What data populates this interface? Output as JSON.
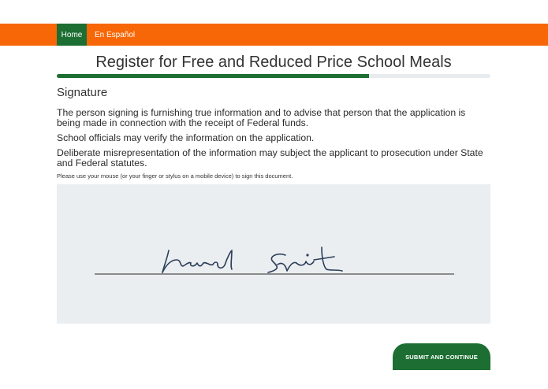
{
  "nav": {
    "home_label": "Home",
    "spanish_label": "En Español"
  },
  "page": {
    "title": "Register for Free and Reduced Price School Meals",
    "progress_fraction": 0.72
  },
  "signature_section": {
    "heading": "Signature",
    "paragraphs": [
      "The person signing is furnishing true information and to advise that person that the application is being made in connection with the receipt of Federal funds.",
      "School officials may verify the information on the application.",
      "Deliberate misrepresentation of the information may subject the applicant to prosecution under State and Federal statutes."
    ],
    "instruction": "Please use your mouse (or your finger or stylus on a mobile device) to sign this document.",
    "signature_text": "Harold Smith"
  },
  "actions": {
    "submit_label": "SUBMIT AND CONTINUE"
  },
  "colors": {
    "topbar": "#f76707",
    "brand_green": "#1d6e33",
    "pad_background": "#ebeef0",
    "ink": "#2c3e5a"
  }
}
